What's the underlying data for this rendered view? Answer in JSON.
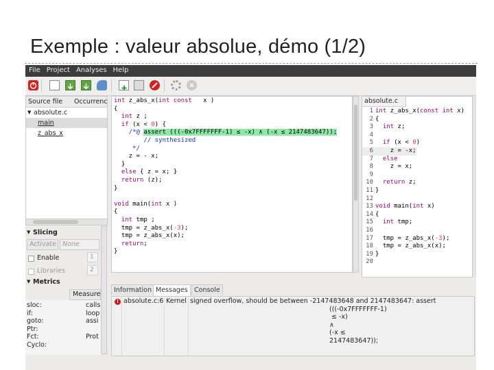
{
  "slide": {
    "title": "Exemple : valeur absolue, démo (1/2)"
  },
  "menu": [
    "File",
    "Project",
    "Analyses",
    "Help"
  ],
  "file_tree": {
    "col_source": "Source file",
    "col_occ": "Occurrenc",
    "file": "absolute.c",
    "items": [
      "main",
      "z_abs_x"
    ]
  },
  "slicing": {
    "title": "Slicing",
    "activate": "Activate",
    "none": "None",
    "enable": "Enable",
    "enable_val": "1",
    "libraries": "Libraries",
    "libraries_val": "2"
  },
  "metrics": {
    "title": "Metrics",
    "measure": "Measure",
    "labels": [
      "sloc:",
      "if:",
      "goto:",
      "Ptr:",
      "Fct:",
      "Cyclo:"
    ],
    "values": [
      "calls",
      "loop",
      "assi",
      "",
      "Prot",
      ""
    ]
  },
  "code_lines": [
    "int z_abs_x(int const   x )",
    "{",
    "  int z ;",
    "  if (x < 0) {",
    "    /*@ assert (((-0x7FFFFFFF-1) ≤ -x) ∧ (-x ≤ 2147483647));",
    "        // synthesized",
    "     */",
    "    z = - x;",
    "  }",
    "  else { z = x; }",
    "  return (z);",
    "}",
    "",
    "void main(int x )",
    "{",
    "  int tmp ;",
    "  tmp = z_abs_x(-3);",
    "  tmp = z_abs_x(x);",
    "  return;",
    "}"
  ],
  "right_pane": {
    "tab": "absolute.c",
    "lines": [
      "int z_abs_x(const int x)",
      "{",
      "  int z;",
      "",
      "  if (x < 0)",
      "    z = -x;",
      "  else",
      "    z = x;",
      "",
      "  return z;",
      "}",
      "",
      "void main(int x)",
      "{",
      "  int tmp;",
      "",
      "  tmp = z_abs_x(-3);",
      "  tmp = z_abs_x(x);",
      "}",
      ""
    ]
  },
  "bottom": {
    "tabs": [
      "Information",
      "Messages",
      "Console"
    ],
    "active_tab": "Messages",
    "message": {
      "location": "absolute.c:6",
      "plugin": "Kernel",
      "text_lines": [
        "signed overflow, should be between -2147483648 and 2147483647: assert",
        "(((-0x7FFFFFFF-1)",
        " ≤ -x)",
        "∧",
        "(-x ≤",
        "2147483647));"
      ]
    }
  },
  "colors": {
    "highlight": "#8fe6a8",
    "keyword": "#a0006e",
    "number": "#ff3030",
    "comment": "#1a33cc"
  }
}
